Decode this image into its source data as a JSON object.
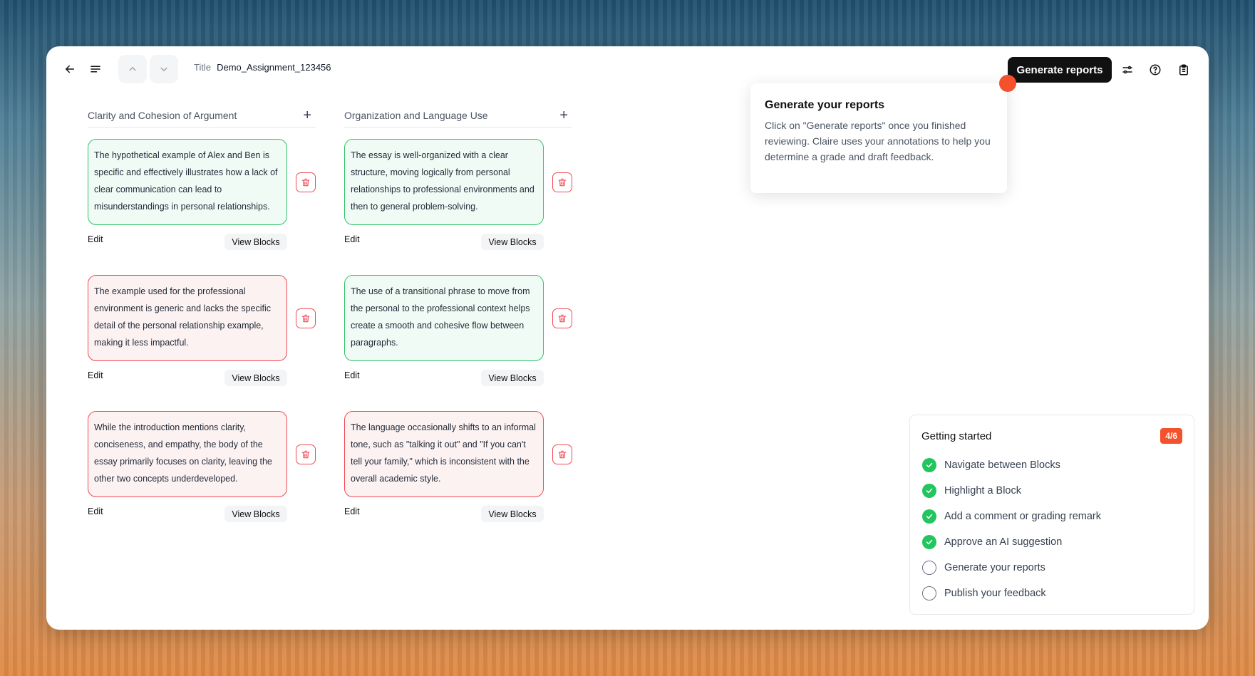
{
  "topbar": {
    "title_label": "Title",
    "title_value": "Demo_Assignment_123456",
    "generate_label": "Generate reports"
  },
  "tooltip": {
    "heading": "Generate your reports",
    "body": "Click on \"Generate reports\" once you finished reviewing. Claire uses your annotations to help you determine a grade and draft feedback."
  },
  "columns": [
    {
      "title": "Clarity and Cohesion of Argument",
      "cards": [
        {
          "text": "The hypothetical example of Alex and Ben is specific and effectively illustrates how a lack of clear communication can lead to misunderstandings in personal relationships.",
          "tone": "green"
        },
        {
          "text": "The example used for the professional environment is generic and lacks the specific detail of the personal relationship example, making it less impactful.",
          "tone": "red"
        },
        {
          "text": "While the introduction mentions clarity, conciseness, and empathy, the body of the essay primarily focuses on clarity, leaving the other two concepts underdeveloped.",
          "tone": "red"
        }
      ]
    },
    {
      "title": "Organization and Language Use",
      "cards": [
        {
          "text": "The essay is well-organized with a clear structure, moving logically from personal relationships to professional environments and then to general problem-solving.",
          "tone": "green"
        },
        {
          "text": "The use of a transitional phrase to move from the personal to the professional context helps create a smooth and cohesive flow between paragraphs.",
          "tone": "green"
        },
        {
          "text": "The language occasionally shifts to an informal tone, such as \"talking it out\" and \"If you can't tell your family,\" which is inconsistent with the overall academic style.",
          "tone": "red"
        }
      ]
    }
  ],
  "card_actions": {
    "edit": "Edit",
    "view_blocks": "View Blocks"
  },
  "getting_started": {
    "title": "Getting started",
    "progress": "4/6",
    "items": [
      {
        "label": "Navigate between Blocks",
        "done": true
      },
      {
        "label": "Highlight a Block",
        "done": true
      },
      {
        "label": "Add a comment or grading remark",
        "done": true
      },
      {
        "label": "Approve an AI suggestion",
        "done": true
      },
      {
        "label": "Generate your reports",
        "done": false
      },
      {
        "label": "Publish your feedback",
        "done": false
      }
    ]
  },
  "colors": {
    "green_border": "#33c36b",
    "red_border": "#ef4a55",
    "accent": "#f4512c"
  }
}
